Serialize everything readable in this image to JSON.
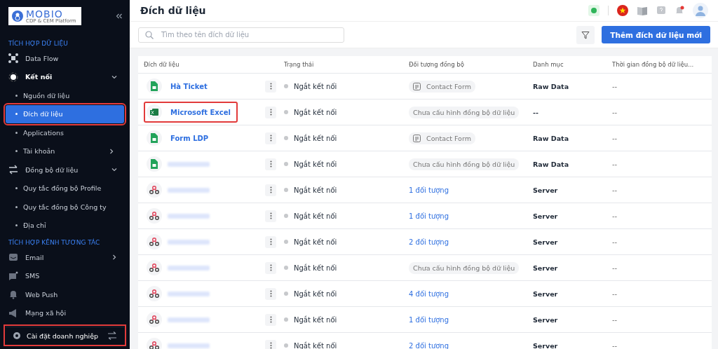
{
  "logo": {
    "name": "MOBIO",
    "tagline": "CDP & CEM Platform"
  },
  "sidebar": {
    "sections": [
      {
        "title": "TÍCH HỢP DỮ LIỆU",
        "items": [
          {
            "label": "Data Flow",
            "active": false
          },
          {
            "label": "Kết nối",
            "active": true,
            "expanded": true,
            "children": [
              {
                "label": "Nguồn dữ liệu",
                "selected": false,
                "highlighted": false
              },
              {
                "label": "Đích dữ liệu",
                "selected": true,
                "highlighted": true
              },
              {
                "label": "Applications",
                "selected": false,
                "highlighted": false
              },
              {
                "label": "Tài khoản",
                "selected": false,
                "highlighted": false,
                "expandable": true
              }
            ]
          },
          {
            "label": "Đồng bộ dữ liệu",
            "active": false,
            "expanded": true,
            "children": [
              {
                "label": "Quy tắc đồng bộ Profile",
                "selected": false,
                "highlighted": false
              },
              {
                "label": "Quy tắc đồng bộ Công ty",
                "selected": false,
                "highlighted": false
              },
              {
                "label": "Địa chỉ",
                "selected": false,
                "highlighted": false
              }
            ]
          }
        ]
      },
      {
        "title": "TÍCH HỢP KÊNH TƯƠNG TÁC",
        "items": [
          {
            "label": "Email",
            "active": false,
            "expanded": false
          },
          {
            "label": "SMS",
            "active": false
          },
          {
            "label": "Web Push",
            "active": false
          },
          {
            "label": "Mạng xã hội",
            "active": false
          }
        ]
      }
    ],
    "footer": {
      "label": "Cài đặt doanh nghiệp",
      "highlighted": true
    }
  },
  "header": {
    "title": "Đích dữ liệu",
    "notification": true
  },
  "toolbar": {
    "search_placeholder": "Tìm theo tên đích dữ liệu",
    "add_button": "Thêm đích dữ liệu mới"
  },
  "table": {
    "columns": [
      "Đích dữ liệu",
      "Trạng thái",
      "Đối tượng đồng bộ",
      "Danh mục",
      "Thời gian đồng bộ dữ liệu..."
    ],
    "rows": [
      {
        "kind": "sheet",
        "name": "Hà Ticket",
        "highlighted": false,
        "status": "Ngắt kết nối",
        "object": {
          "kind": "form",
          "text": "Contact Form"
        },
        "category": "Raw Data",
        "time": "--"
      },
      {
        "kind": "excel",
        "name": "Microsoft Excel",
        "highlighted": true,
        "status": "Ngắt kết nối",
        "object": {
          "kind": "unconfigured",
          "text": "Chưa cấu hình đồng bộ dữ liệu"
        },
        "category": "--",
        "time": "--"
      },
      {
        "kind": "sheet",
        "name": "Form LDP",
        "highlighted": false,
        "status": "Ngắt kết nối",
        "object": {
          "kind": "form",
          "text": "Contact Form"
        },
        "category": "Raw Data",
        "time": "--"
      },
      {
        "kind": "sheet",
        "highlighted": false,
        "status": "Ngắt kết nối",
        "object": {
          "kind": "unconfigured",
          "text": "Chưa cấu hình đồng bộ dữ liệu"
        },
        "category": "Raw Data",
        "time": "--"
      },
      {
        "kind": "webhook",
        "highlighted": false,
        "status": "Ngắt kết nối",
        "object": {
          "kind": "link",
          "text": "1 đối tượng"
        },
        "category": "Server",
        "time": "--"
      },
      {
        "kind": "webhook",
        "highlighted": false,
        "status": "Ngắt kết nối",
        "object": {
          "kind": "link",
          "text": "1 đối tượng"
        },
        "category": "Server",
        "time": "--"
      },
      {
        "kind": "webhook",
        "highlighted": false,
        "status": "Ngắt kết nối",
        "object": {
          "kind": "link",
          "text": "2 đối tượng"
        },
        "category": "Server",
        "time": "--"
      },
      {
        "kind": "webhook",
        "highlighted": false,
        "status": "Ngắt kết nối",
        "object": {
          "kind": "unconfigured",
          "text": "Chưa cấu hình đồng bộ dữ liệu"
        },
        "category": "Server",
        "time": "--"
      },
      {
        "kind": "webhook",
        "highlighted": false,
        "status": "Ngắt kết nối",
        "object": {
          "kind": "link",
          "text": "4 đối tượng"
        },
        "category": "Server",
        "time": "--"
      },
      {
        "kind": "webhook",
        "highlighted": false,
        "status": "Ngắt kết nối",
        "object": {
          "kind": "link",
          "text": "1 đối tượng"
        },
        "category": "Server",
        "time": "--"
      },
      {
        "kind": "webhook",
        "highlighted": false,
        "status": "Ngắt kết nối",
        "object": {
          "kind": "link",
          "text": "2 đối tượng"
        },
        "category": "Server",
        "time": "--"
      }
    ]
  }
}
